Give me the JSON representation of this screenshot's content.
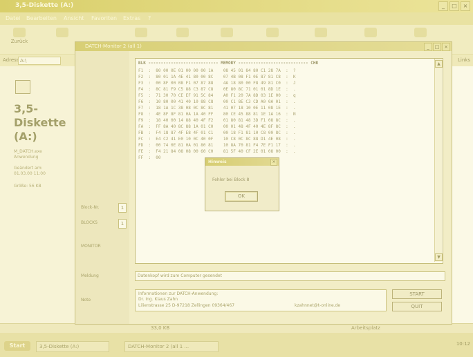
{
  "explorer": {
    "title": "3,5-Diskette (A:)",
    "menu": [
      "Datei",
      "Bearbeiten",
      "Ansicht",
      "Favoriten",
      "Extras",
      "?"
    ],
    "toolbar": [
      "Zurück",
      "",
      "Aufwärts",
      "Suchen",
      "Ordner",
      "Verlauf",
      "",
      "",
      "",
      "Ansichten"
    ],
    "address_label": "Adresse",
    "address_value": "A:\\",
    "links_label": "Links",
    "drive_title": "3,5-Diskette (A:)",
    "left_lines": [
      "M_DATCH.exe",
      "Anwendung",
      "",
      "Geändert am:",
      "01.03.00 11:00",
      "",
      "Größe: 56 KB"
    ],
    "status": {
      "size": "33,0 KB",
      "location": "Arbeitsplatz"
    }
  },
  "taskbar": {
    "start": "Start",
    "buttons": [
      "3,5-Diskette (A:)",
      "DATCH-Monitor 2 (all 1 ..."
    ],
    "clock": "10:12"
  },
  "app": {
    "title": "DATCH-Monitor 2 (all 1)",
    "fields": {
      "block_nr_label": "Block-Nr.",
      "block_nr_value": "1",
      "blocks_label": "BLOCKS",
      "blocks_value": "1",
      "monitor_label": "MONITOR",
      "message_label": "Meldung",
      "note_label": "Note"
    },
    "monitor_header": "BLK   ---------------------------- MEMORY ---------------------------- CHR",
    "rows": [
      "F1  :  80 00 0E 01 00 00 00 1A    08 45 01 84 80 C1 28 7A  :  ?",
      "F2  :  80 01 1A 4E 41 80 00 8C    07 4B 08 F1 0E 87 81 C8  :  K",
      "F3  :  00 8F 00 08 F1 07 87 88    4A 18 80 00 F8 49 81 C0  :  J",
      "F4  :  8C 81 F9 C5 88 C3 87 C8    0E 80 8C 71 01 01 8D 1E  :  .",
      "F5  :  71 30 70 CE EF 91 5C 84    A0 F1 20 7A 8D 03 1E 00  :  q",
      "F6  :  10 80 00 41 40 10 88 C8    00 C1 8E C3 CD A0 0A 01  :  .",
      "F7  :  18 1A 1C 38 08 0C 8C 81    41 07 18 10 0E 11 08 1E  :  .",
      "F8  :  4E 8F 8F 81 0A 1A 40 FF    80 CE 45 88 81 1E 1A 16  :  N",
      "F9  :  18 40 00 14 88 40 4F F2    01 80 81 48 3D F1 08 8C  :  .",
      "FA  :  FF 8A 40 8C 88 1A 01 C0    00 01 48 4F 40 4E 8F 8C  :  .",
      "FB  :  F4 18 87 4F E8 4F 01 C1    00 18 F1 81 10 C8 00 8C  :  .",
      "FC  :  E4 C2 41 E0 10 0C 40 0F    10 C8 0C 8C 88 D1 4E 08  :  .",
      "FD  :  00 74 0E 81 0A 01 80 81    10 8A 70 81 F4 7E F1 17  :  .",
      "FE  :  F4 21 84 08 08 00 60 C0    81 5F 40 CF 2E 01 08 00  :  .",
      "FF  :  00"
    ],
    "message": "Datenkopf wird zum Computer gesendet",
    "info": [
      "Informationen zur DATCH-Anwendung:",
      "Dr. Ing. Klaus Zahn",
      "Lilienstrasse 25  D-97218 Zellingen 09364/467",
      "kzahnnet@t-online.de"
    ],
    "buttons": {
      "start": "START",
      "quit": "QUIT"
    }
  },
  "dialog": {
    "title": "Hinweis",
    "message": "Fehler bei Block 8",
    "ok": "OK"
  }
}
